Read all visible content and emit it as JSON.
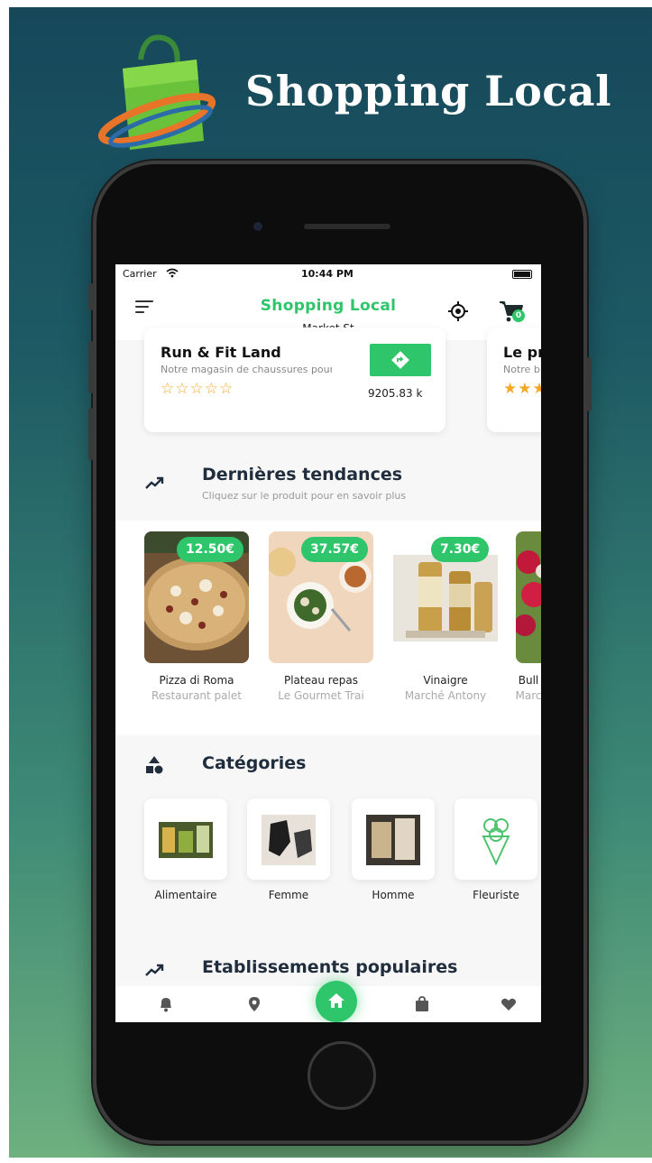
{
  "brand": {
    "title": "Shopping Local"
  },
  "status": {
    "carrier": "Carrier",
    "time": "10:44 PM"
  },
  "nav": {
    "title": "Shopping Local",
    "subtitle": "Market St",
    "cart_count": "0"
  },
  "shops": [
    {
      "name": "Run & Fit Land",
      "desc": "Notre magasin de chaussures pour",
      "stars": "☆☆☆☆☆",
      "distance": "9205.83 k"
    },
    {
      "name": "Le pri",
      "desc": "Notre b",
      "stars": "★★★"
    }
  ],
  "trends": {
    "title": "Dernières tendances",
    "subtitle": "Cliquez sur le produit pour en savoir plus",
    "products": [
      {
        "price": "12.50€",
        "name": "Pizza di Roma",
        "shop": "Restaurant palet"
      },
      {
        "price": "37.57€",
        "name": "Plateau repas",
        "shop": "Le Gourmet Trai"
      },
      {
        "price": "7.30€",
        "name": "Vinaigre",
        "shop": "Marché Antony"
      },
      {
        "price": "",
        "name": "Bull",
        "shop": "Marc"
      }
    ]
  },
  "categories": {
    "title": "Catégories",
    "items": [
      {
        "label": "Alimentaire"
      },
      {
        "label": "Femme"
      },
      {
        "label": "Homme"
      },
      {
        "label": "Fleuriste"
      }
    ]
  },
  "popular": {
    "title": "Etablissements populaires"
  },
  "tabbar": {
    "items": [
      "bell-icon",
      "location-pin-icon",
      "home-icon",
      "shopping-bag-icon",
      "heart-icon"
    ],
    "active": "home-icon"
  },
  "colors": {
    "accent": "#2fc56a",
    "star": "#f4a825",
    "background_top": "#16485a",
    "background_bottom": "#6fb07f"
  }
}
